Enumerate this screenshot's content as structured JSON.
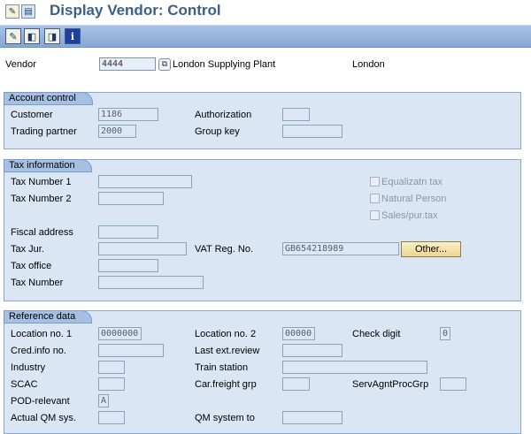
{
  "header": {
    "title": "Display Vendor: Control"
  },
  "vendor": {
    "label": "Vendor",
    "value": "4444",
    "name": "London Supplying Plant",
    "city": "London"
  },
  "account_control": {
    "title": "Account control",
    "customer_label": "Customer",
    "customer": "1186",
    "trading_partner_label": "Trading partner",
    "trading_partner": "2000",
    "authorization_label": "Authorization",
    "authorization": "",
    "group_key_label": "Group key",
    "group_key": ""
  },
  "tax": {
    "title": "Tax information",
    "tax1_label": "Tax Number 1",
    "tax2_label": "Tax Number 2",
    "fiscal_label": "Fiscal address",
    "taxjur_label": "Tax Jur.",
    "vat_label": "VAT Reg. No.",
    "vat": "GB654218989",
    "other_button": "Other...",
    "tax_office_label": "Tax office",
    "tax_number_label": "Tax Number",
    "equalizatn_label": "Equalizatn tax",
    "natural_label": "Natural Person",
    "sales_label": "Sales/pur.tax"
  },
  "reference": {
    "title": "Reference data",
    "loc1_label": "Location no. 1",
    "loc1": "0000000",
    "loc2_label": "Location no. 2",
    "loc2": "00000",
    "check_label": "Check digit",
    "check": "0",
    "cred_label": "Cred.info no.",
    "last_ext_label": "Last ext.review",
    "industry_label": "Industry",
    "train_label": "Train station",
    "scac_label": "SCAC",
    "carfreight_label": "Car.freight grp",
    "servagnt_label": "ServAgntProcGrp",
    "pod_label": "POD-relevant",
    "pod": "A",
    "actual_qm_label": "Actual QM sys.",
    "qm_to_label": "QM system to"
  }
}
